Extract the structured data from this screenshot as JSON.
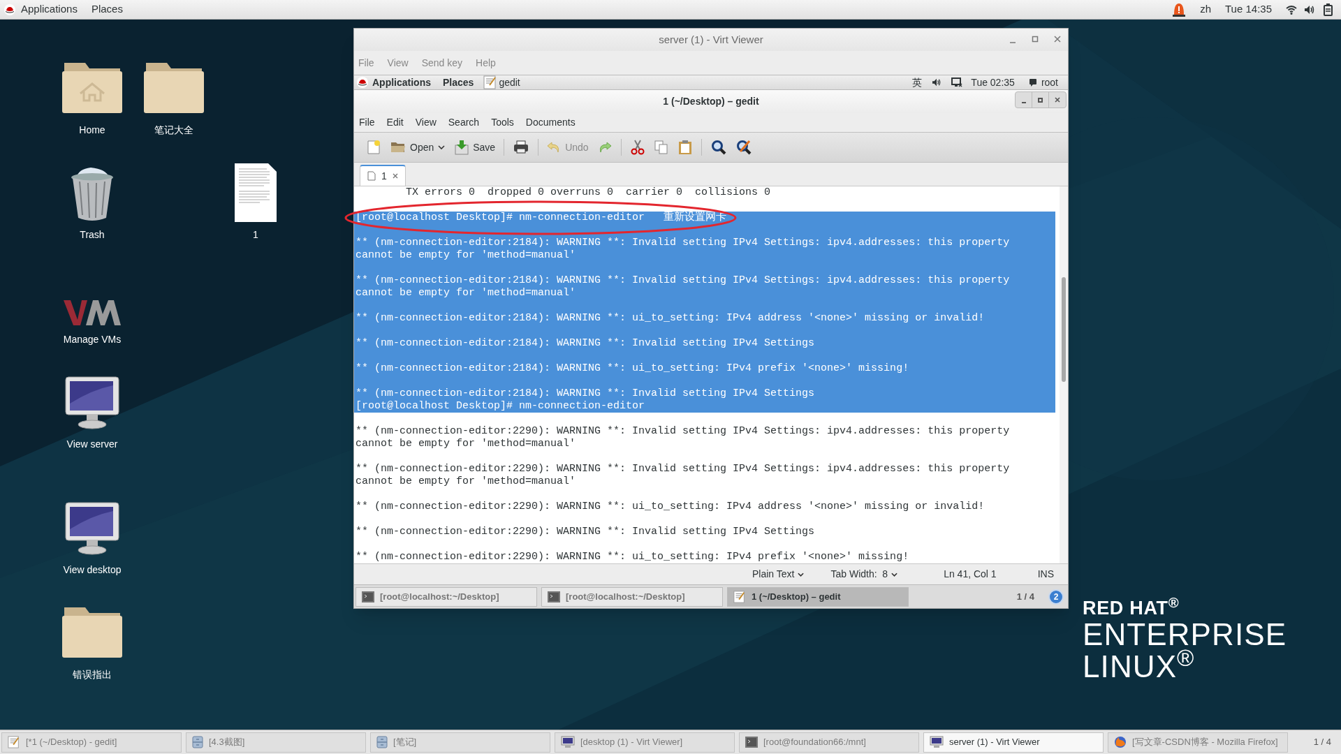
{
  "top_bar": {
    "applications": "Applications",
    "places": "Places",
    "input_method": "zh",
    "clock": "Tue 14:35"
  },
  "desktop_icons": [
    {
      "label": "Home",
      "kind": "home"
    },
    {
      "label": "笔记大全",
      "kind": "folder"
    },
    {
      "label": "Trash",
      "kind": "trash"
    },
    {
      "label": "1",
      "kind": "document"
    },
    {
      "label": "Manage VMs",
      "kind": "vm"
    },
    {
      "label": "View server",
      "kind": "monitor"
    },
    {
      "label": "View desktop",
      "kind": "monitor"
    },
    {
      "label": "错误指出",
      "kind": "folder"
    }
  ],
  "branding": [
    "RED HAT$^{®}$",
    "ENTERPRISE",
    "LINUX$^{®}$"
  ],
  "viewer": {
    "title": "server (1) - Virt Viewer",
    "menu": [
      "File",
      "View",
      "Send key",
      "Help"
    ],
    "guest_panel": {
      "applications": "Applications",
      "places": "Places",
      "app": "gedit",
      "input_method": "英",
      "clock": "Tue 02:35",
      "user": "root"
    },
    "gedit": {
      "title": "1 (~/Desktop) – gedit",
      "menu": [
        "File",
        "Edit",
        "View",
        "Search",
        "Tools",
        "Documents"
      ],
      "toolbar": [
        {
          "kind": "new",
          "disabled": false
        },
        {
          "kind": "open",
          "label": "Open",
          "disabled": false
        },
        {
          "kind": "save",
          "label": "Save",
          "disabled": false
        },
        {
          "kind": "print",
          "disabled": false
        },
        {
          "kind": "undo",
          "label": "Undo",
          "disabled": true
        },
        {
          "kind": "redo",
          "disabled": false
        },
        {
          "kind": "cut",
          "disabled": false
        },
        {
          "kind": "copy",
          "disabled": false
        },
        {
          "kind": "paste",
          "disabled": false
        },
        {
          "kind": "find",
          "disabled": false
        },
        {
          "kind": "replace",
          "disabled": false
        }
      ],
      "tabs": [
        {
          "label": "1",
          "selected": true
        }
      ],
      "blocks": [
        {
          "lines": [
            "        TX errors 0  dropped 0 overruns 0  carrier 0  collisions 0"
          ],
          "selected": false,
          "circled": false
        },
        {
          "lines": [
            "[root@localhost Desktop]# nm-connection-editor   重新设置网卡"
          ],
          "selected": true,
          "circled": true
        },
        {
          "lines": [
            "** (nm-connection-editor:2184): WARNING **: Invalid setting IPv4 Settings: ipv4.addresses: this property",
            "cannot be empty for 'method=manual'"
          ],
          "selected": true,
          "circled": false
        },
        {
          "lines": [
            "** (nm-connection-editor:2184): WARNING **: Invalid setting IPv4 Settings: ipv4.addresses: this property",
            "cannot be empty for 'method=manual'"
          ],
          "selected": true,
          "circled": false
        },
        {
          "lines": [
            "** (nm-connection-editor:2184): WARNING **: ui_to_setting: IPv4 address '<none>' missing or invalid!"
          ],
          "selected": true,
          "circled": false
        },
        {
          "lines": [
            "** (nm-connection-editor:2184): WARNING **: Invalid setting IPv4 Settings"
          ],
          "selected": true,
          "circled": false
        },
        {
          "lines": [
            "** (nm-connection-editor:2184): WARNING **: ui_to_setting: IPv4 prefix '<none>' missing!"
          ],
          "selected": true,
          "circled": false
        },
        {
          "lines": [
            "** (nm-connection-editor:2184): WARNING **: Invalid setting IPv4 Settings",
            "[root@localhost Desktop]# nm-connection-editor"
          ],
          "selected": true,
          "circled": false
        },
        {
          "lines": [
            "** (nm-connection-editor:2290): WARNING **: Invalid setting IPv4 Settings: ipv4.addresses: this property",
            "cannot be empty for 'method=manual'"
          ],
          "selected": false,
          "circled": false
        },
        {
          "lines": [
            "** (nm-connection-editor:2290): WARNING **: Invalid setting IPv4 Settings: ipv4.addresses: this property",
            "cannot be empty for 'method=manual'"
          ],
          "selected": false,
          "circled": false
        },
        {
          "lines": [
            "** (nm-connection-editor:2290): WARNING **: ui_to_setting: IPv4 address '<none>' missing or invalid!"
          ],
          "selected": false,
          "circled": false
        },
        {
          "lines": [
            "** (nm-connection-editor:2290): WARNING **: Invalid setting IPv4 Settings"
          ],
          "selected": false,
          "circled": false
        },
        {
          "lines": [
            "** (nm-connection-editor:2290): WARNING **: ui_to_setting: IPv4 prefix '<none>' missing!"
          ],
          "selected": false,
          "circled": false
        }
      ],
      "status": {
        "language": "Plain Text",
        "tab_width": "Tab Width:  8",
        "position": "Ln 41, Col 1",
        "mode": "INS"
      }
    },
    "taskbar": [
      {
        "label": "[root@localhost:~/Desktop]",
        "kind": "terminal",
        "selected": false
      },
      {
        "label": "[root@localhost:~/Desktop]",
        "kind": "terminal",
        "selected": false
      },
      {
        "label": "1 (~/Desktop) – gedit",
        "kind": "editor",
        "selected": true
      }
    ],
    "pager": "1 / 4",
    "badge": "2"
  },
  "taskbar": [
    {
      "label": "[*1 (~/Desktop) - gedit]",
      "kind": "editor",
      "selected": false
    },
    {
      "label": "[4.3截图]",
      "kind": "files",
      "selected": false
    },
    {
      "label": "[笔记]",
      "kind": "files",
      "selected": false
    },
    {
      "label": "[desktop (1) - Virt Viewer]",
      "kind": "viewer",
      "selected": false
    },
    {
      "label": "[root@foundation66:/mnt]",
      "kind": "terminal",
      "selected": false
    },
    {
      "label": "server (1) - Virt Viewer",
      "kind": "viewer",
      "selected": true
    },
    {
      "label": "[写文章-CSDN博客 - Mozilla Firefox]",
      "kind": "browser",
      "selected": false
    }
  ],
  "pager": "1 / 4"
}
